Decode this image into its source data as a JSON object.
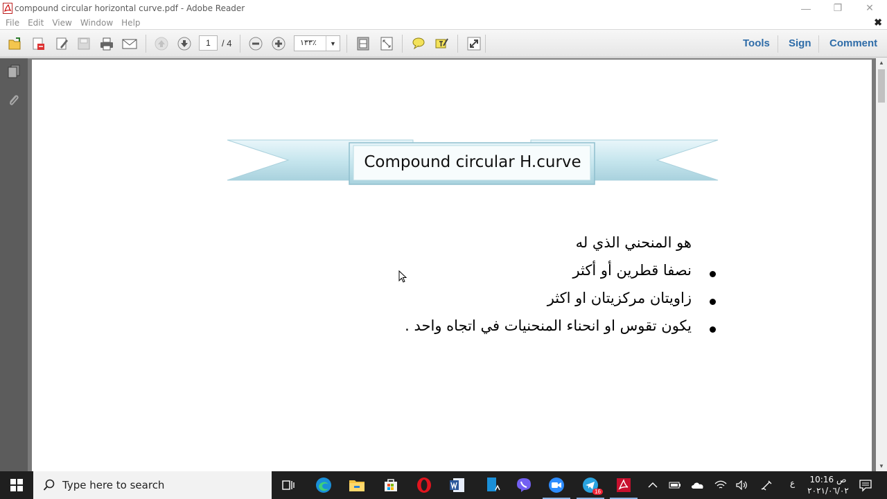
{
  "window": {
    "title": "compound circular horizontal curve.pdf - Adobe Reader",
    "controls": {
      "minimize": "—",
      "maximize": "❐",
      "close": "✕"
    }
  },
  "menu": {
    "items": [
      "File",
      "Edit",
      "View",
      "Window",
      "Help"
    ],
    "doc_close": "✖"
  },
  "toolbar": {
    "page_current": "1",
    "page_total": "/ 4",
    "zoom": "١٣٣٪",
    "zoom_arrow": "▼",
    "right_links": {
      "tools": "Tools",
      "sign": "Sign",
      "comment": "Comment"
    }
  },
  "document": {
    "banner_title": "Compound circular H.curve",
    "intro": "هو المنحني الذي له",
    "bullets": [
      "نصفا قطرين أو أكثر",
      "زاويتان مركزيتان او اكثر",
      "يكون تقوس او انحناء   المنحنيات في اتجاه واحد ."
    ]
  },
  "taskbar": {
    "search_placeholder": "Type here to search",
    "lang": "ع",
    "clock_time": "10:16 ص",
    "clock_date": "٢٠٢١/٠٦/٠٢",
    "telegram_badge": "16"
  }
}
